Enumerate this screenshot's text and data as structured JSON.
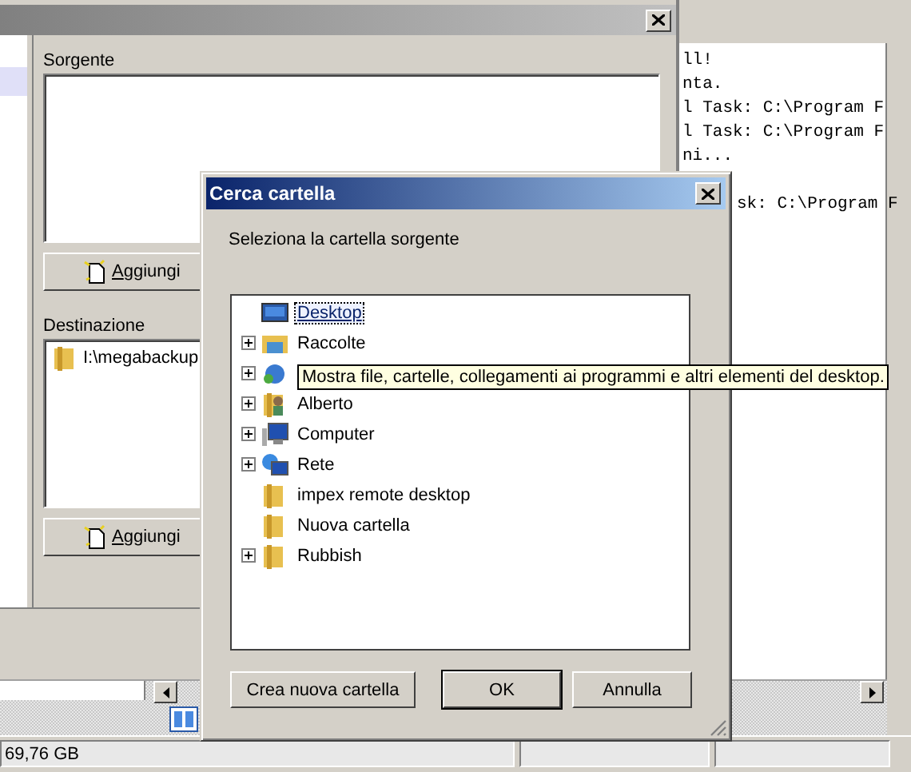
{
  "console": {
    "blocks": [
      {
        "lines": [
          "ll!",
          "nta.",
          "l Task: C:\\Program F",
          "l Task: C:\\Program F",
          "ni..."
        ]
      },
      {
        "lines": [
          "sk: C:\\Program F"
        ]
      }
    ]
  },
  "main_window": {
    "sections": [
      {
        "label": "Sorgente",
        "button": "Aggiungi"
      },
      {
        "label": "Destinazione",
        "items": [
          "I:\\megabackup"
        ],
        "button": "Aggiungi"
      }
    ]
  },
  "status_bar": {
    "free_space": "69,76 GB"
  },
  "dialog": {
    "title": "Cerca cartella",
    "prompt": "Seleziona la cartella sorgente",
    "tree": [
      {
        "label": "Desktop",
        "kind": "desktop",
        "expandable": false,
        "selected": true
      },
      {
        "label": "Raccolte",
        "kind": "library",
        "expandable": true,
        "selected": false
      },
      {
        "kind": "network",
        "expandable": true,
        "selected": false
      },
      {
        "label": "Alberto",
        "kind": "user",
        "expandable": true,
        "selected": false
      },
      {
        "label": "Computer",
        "kind": "computer",
        "expandable": true,
        "selected": false
      },
      {
        "label": "Rete",
        "kind": "globe",
        "expandable": true,
        "selected": false
      },
      {
        "label": "impex remote desktop",
        "kind": "folder",
        "expandable": false,
        "selected": false
      },
      {
        "label": "Nuova cartella",
        "kind": "folder",
        "expandable": false,
        "selected": false
      },
      {
        "label": "Rubbish",
        "kind": "folder",
        "expandable": true,
        "selected": false
      }
    ],
    "tooltip": "Mostra file, cartelle, collegamenti ai programmi e altri elementi del desktop.",
    "buttons": [
      {
        "label": "Crea nuova cartella",
        "default": false
      },
      {
        "label": "OK",
        "default": true
      },
      {
        "label": "Annulla",
        "default": false
      }
    ]
  }
}
